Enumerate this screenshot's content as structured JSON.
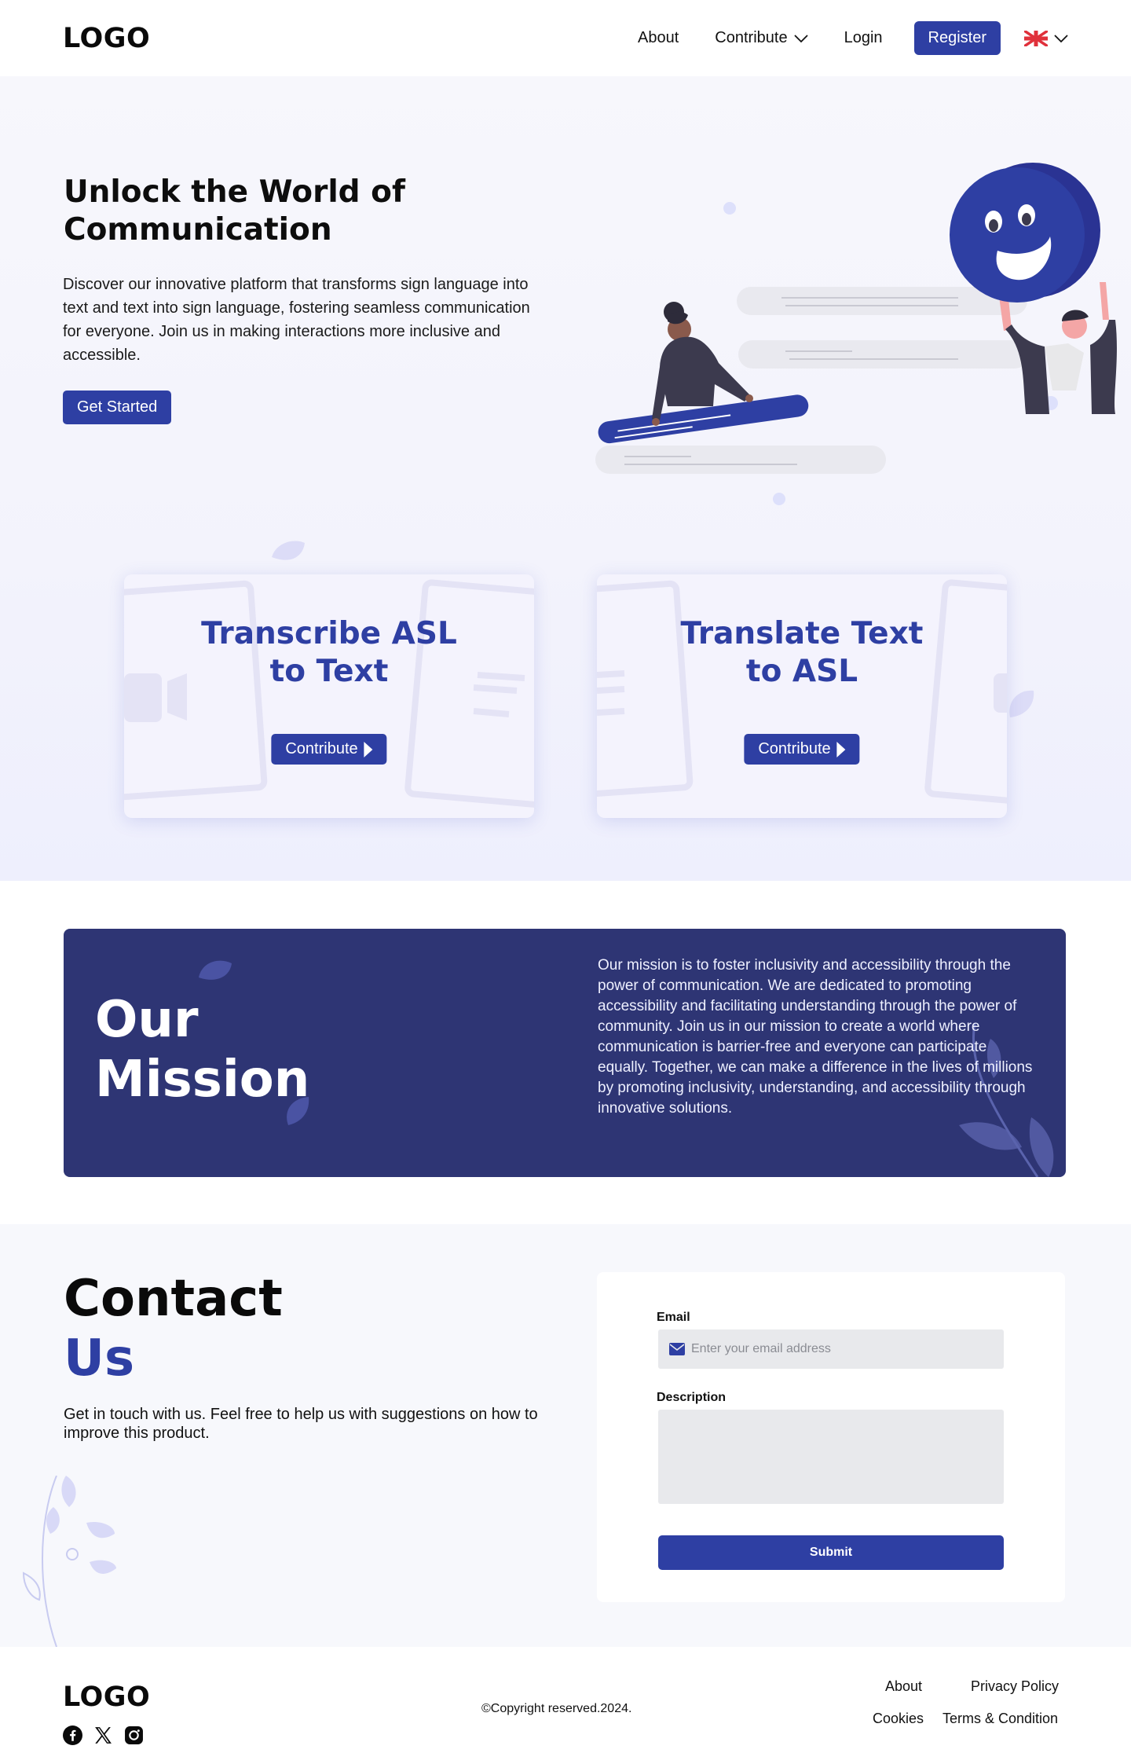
{
  "nav": {
    "logo": "LOGO",
    "about": "About",
    "contribute": "Contribute",
    "login": "Login",
    "register": "Register"
  },
  "hero": {
    "title": "Unlock the World of Communication",
    "description": "Discover our innovative platform that transforms sign language into text and text into sign language, fostering seamless communication for everyone. Join us in making interactions more inclusive and accessible.",
    "cta": "Get Started"
  },
  "cards": [
    {
      "title_line1": "Transcribe ASL",
      "title_line2": "to Text",
      "button": "Contribute"
    },
    {
      "title_line1": "Translate Text",
      "title_line2": "to ASL",
      "button": "Contribute"
    }
  ],
  "mission": {
    "title_line1": "Our",
    "title_line2": "Mission",
    "text": "Our mission is to foster inclusivity and accessibility through the power of communication. We are dedicated to promoting accessibility and facilitating understanding through the power of community. Join us in our mission to create a world where communication is barrier-free and everyone can participate equally. Together, we can make a difference in the lives of millions by promoting inclusivity, understanding, and accessibility through innovative solutions."
  },
  "contact": {
    "title_line1": "Contact",
    "title_line2": "Us",
    "description": "Get in touch with us. Feel free to help us with suggestions on how to improve this product.",
    "email_label": "Email",
    "email_placeholder": "Enter your email address",
    "description_label": "Description",
    "submit": "Submit"
  },
  "footer": {
    "logo": "LOGO",
    "copyright": "©Copyright reserved.2024.",
    "about": "About",
    "privacy": "Privacy Policy",
    "cookies": "Cookies",
    "terms": "Terms & Condition"
  },
  "colors": {
    "primary": "#2e3fa3",
    "mission_bg": "#2e3574",
    "hero_bg": "#f4f4fc",
    "input_bg": "#e8e9ec"
  },
  "icons": [
    "chevron-down-icon",
    "uk-flag-icon",
    "play-icon",
    "mail-icon",
    "facebook-icon",
    "x-icon",
    "instagram-icon"
  ]
}
